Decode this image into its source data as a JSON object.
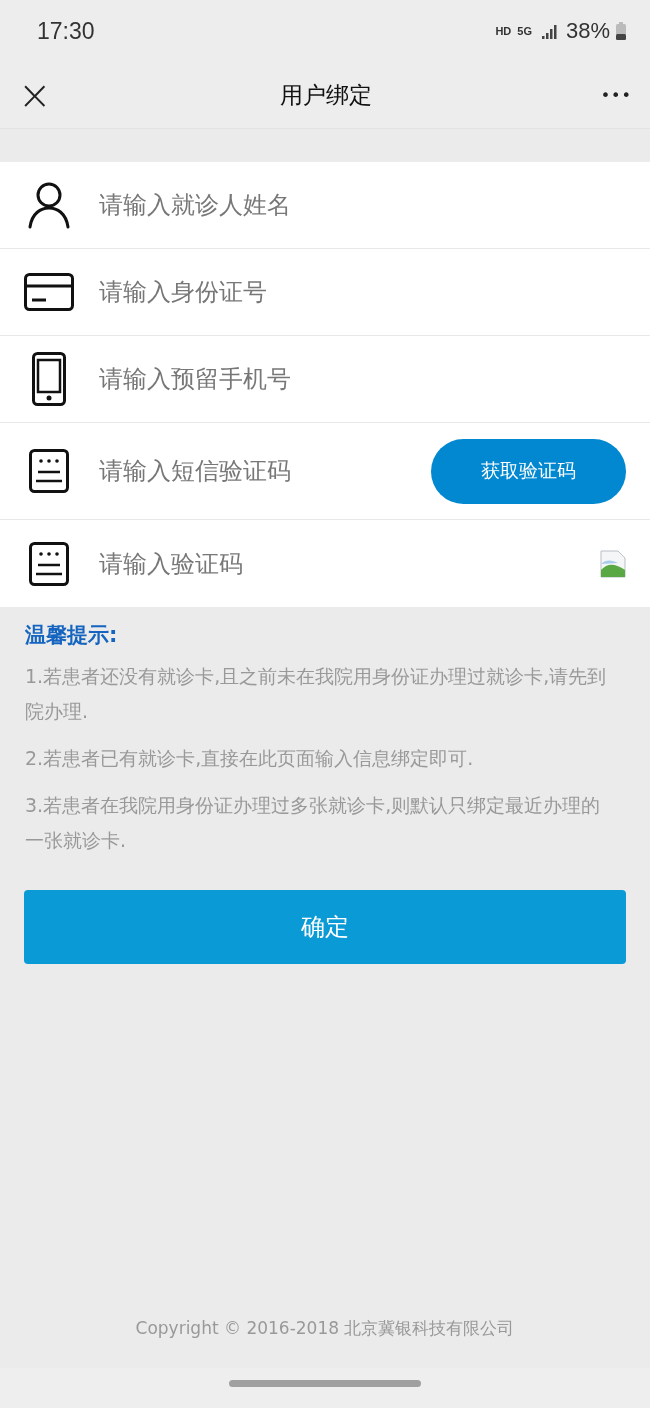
{
  "status_bar": {
    "time": "17:30",
    "hd": "HD",
    "network": "5G",
    "battery": "38%"
  },
  "nav": {
    "close": "×",
    "title": "用户绑定",
    "more": "•••"
  },
  "fields": [
    {
      "kind": "plain",
      "placeholder": "请输入就诊人姓名"
    },
    {
      "kind": "plain",
      "placeholder": "请输入身份证号"
    },
    {
      "kind": "plain",
      "placeholder": "请输入预留手机号"
    },
    {
      "kind": "sms",
      "placeholder": "请输入短信验证码",
      "button": "获取验证码"
    },
    {
      "kind": "captcha",
      "placeholder": "请输入验证码"
    }
  ],
  "notice": {
    "title": "温馨提示:",
    "items": [
      "1.若患者还没有就诊卡,且之前未在我院用身份证办理过就诊卡,请先到院办理.",
      "2.若患者已有就诊卡,直接在此页面输入信息绑定即可.",
      "3.若患者在我院用身份证办理过多张就诊卡,则默认只绑定最近办理的一张就诊卡."
    ]
  },
  "submit": "确定",
  "footer": "Copyright © 2016-2018 北京冀银科技有限公司"
}
